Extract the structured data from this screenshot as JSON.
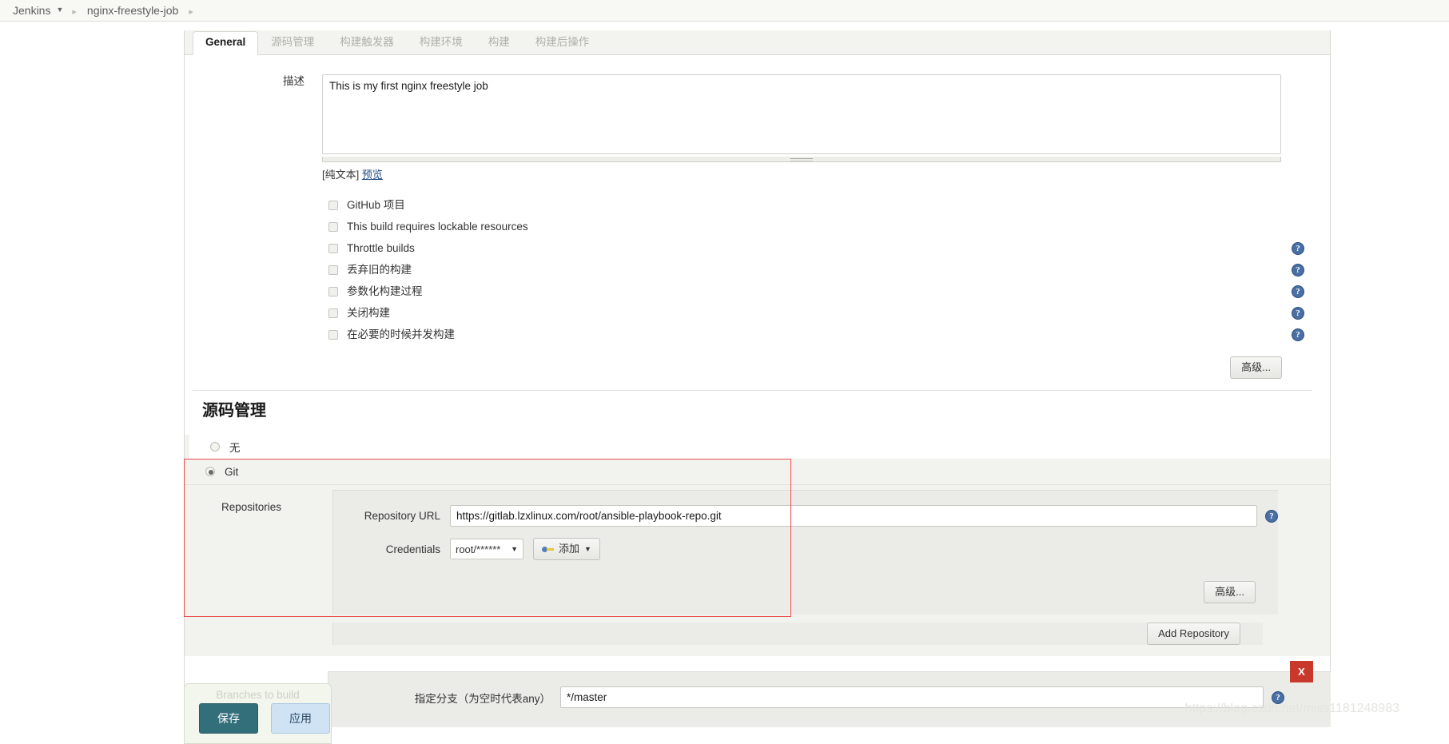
{
  "breadcrumb": {
    "root": "Jenkins",
    "job": "nginx-freestyle-job"
  },
  "tabs": [
    {
      "label": "General",
      "active": true
    },
    {
      "label": "源码管理",
      "active": false
    },
    {
      "label": "构建触发器",
      "active": false
    },
    {
      "label": "构建环境",
      "active": false
    },
    {
      "label": "构建",
      "active": false
    },
    {
      "label": "构建后操作",
      "active": false
    }
  ],
  "general": {
    "description_label": "描述",
    "description_value": "This is my first nginx freestyle job",
    "plaintext_label": "[纯文本]",
    "preview_label": "预览",
    "checkboxes": [
      {
        "label": "GitHub 项目",
        "checked": false,
        "help": false
      },
      {
        "label": "This build requires lockable resources",
        "checked": false,
        "help": false
      },
      {
        "label": "Throttle builds",
        "checked": false,
        "help": true
      },
      {
        "label": "丢弃旧的构建",
        "checked": false,
        "help": true
      },
      {
        "label": "参数化构建过程",
        "checked": false,
        "help": true
      },
      {
        "label": "关闭构建",
        "checked": false,
        "help": true
      },
      {
        "label": "在必要的时候并发构建",
        "checked": false,
        "help": true
      }
    ],
    "advanced_button": "高级..."
  },
  "scm": {
    "section_title": "源码管理",
    "options": [
      {
        "label": "无",
        "selected": false
      },
      {
        "label": "Git",
        "selected": true
      }
    ],
    "repositories_label": "Repositories",
    "repository_url_label": "Repository URL",
    "repository_url_value": "https://gitlab.lzxlinux.com/root/ansible-playbook-repo.git",
    "credentials_label": "Credentials",
    "credentials_value": "root/******",
    "add_credentials_label": "添加",
    "advanced_button": "高级...",
    "add_repository_button": "Add Repository",
    "delete_button": "X",
    "branches_label": "Branches to build",
    "branch_spec_label": "指定分支（为空时代表any）",
    "branch_spec_value": "*/master"
  },
  "footer": {
    "save_label": "保存",
    "apply_label": "应用"
  },
  "watermark": "https://blog.csdn.net/miss1181248983",
  "colors": {
    "accent": "#336e7b",
    "apply": "#cfe3f5",
    "highlight": "#e94c4c",
    "delete": "#c9392b",
    "help": "#4a6fa5"
  }
}
